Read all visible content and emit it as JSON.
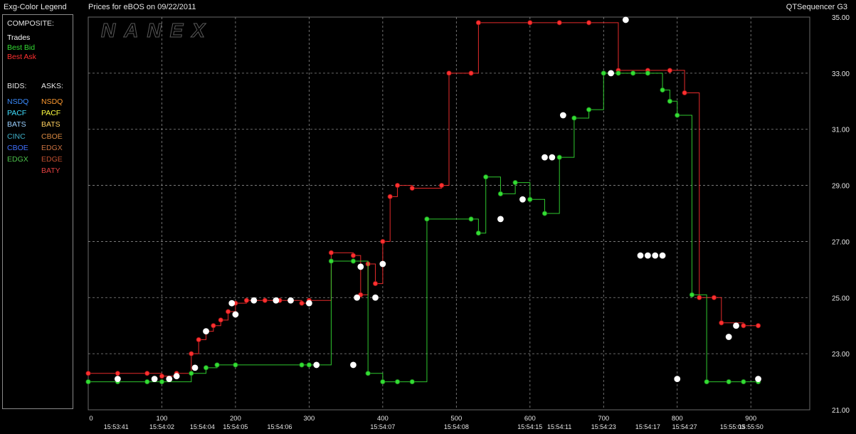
{
  "header": {
    "legend_title": "Exg-Color Legend",
    "chart_title": "Prices for  eBOS  on  09/22/2011",
    "app_name": "QTSequencer G3"
  },
  "legend": {
    "composite_label": "COMPOSITE:",
    "composite": [
      {
        "label": "Trades",
        "color": "#ffffff"
      },
      {
        "label": "Best Bid",
        "color": "#33dd33"
      },
      {
        "label": "Best Ask",
        "color": "#ff3030"
      }
    ],
    "bids_label": "BIDS:",
    "asks_label": "ASKS:",
    "bids": [
      {
        "label": "NSDQ",
        "color": "#3a8cff"
      },
      {
        "label": "PACF",
        "color": "#3fe0ff"
      },
      {
        "label": "BATS",
        "color": "#9ad0ff"
      },
      {
        "label": "CINC",
        "color": "#3fb0c8"
      },
      {
        "label": "CBOE",
        "color": "#4070ff"
      },
      {
        "label": "EDGX",
        "color": "#4cc24c"
      }
    ],
    "asks": [
      {
        "label": "NSDQ",
        "color": "#ff9a30"
      },
      {
        "label": "PACF",
        "color": "#ffff40"
      },
      {
        "label": "BATS",
        "color": "#ffd060"
      },
      {
        "label": "CBOE",
        "color": "#d88840"
      },
      {
        "label": "EDGX",
        "color": "#c87040"
      },
      {
        "label": "EDGE",
        "color": "#c05030"
      },
      {
        "label": "BATY",
        "color": "#e04040"
      }
    ]
  },
  "watermark": "NANEX",
  "chart_data": {
    "type": "line",
    "ylim": [
      21,
      35
    ],
    "xlim": [
      0,
      980
    ],
    "y_ticks": [
      21.0,
      23.0,
      25.0,
      27.0,
      29.0,
      31.0,
      33.0,
      35.0
    ],
    "y_tick_labels": [
      "21.00",
      "23.00",
      "25.00",
      "27.00",
      "29.00",
      "31.00",
      "33.00",
      "35.00"
    ],
    "x_ticks": [
      {
        "x": 0,
        "label": "0",
        "time": ""
      },
      {
        "x": 100,
        "label": "100",
        "time": "15:54:02"
      },
      {
        "x": 200,
        "label": "200",
        "time": "15:54:05"
      },
      {
        "x": 300,
        "label": "300",
        "time": ""
      },
      {
        "x": 400,
        "label": "400",
        "time": "15:54:07"
      },
      {
        "x": 500,
        "label": "500",
        "time": "15:54:08"
      },
      {
        "x": 600,
        "label": "600",
        "time": "15:54:15"
      },
      {
        "x": 700,
        "label": "700",
        "time": "15:54:23"
      },
      {
        "x": 800,
        "label": "800",
        "time": ""
      },
      {
        "x": 900,
        "label": "900",
        "time": "15:55:50"
      }
    ],
    "extra_time_labels": [
      {
        "x": 38,
        "time": "15:53:41"
      },
      {
        "x": 155,
        "time": "15:54:04"
      },
      {
        "x": 260,
        "time": "15:54:06"
      },
      {
        "x": 640,
        "time": "15:54:11"
      },
      {
        "x": 760,
        "time": "15:54:17"
      },
      {
        "x": 810,
        "time": "15:54:27"
      },
      {
        "x": 875,
        "time": "15:55:03"
      }
    ],
    "grid": "dashed",
    "series": [
      {
        "name": "Best Ask",
        "color": "#ff3030",
        "markers": true,
        "points": [
          [
            0,
            22.3
          ],
          [
            40,
            22.3
          ],
          [
            80,
            22.3
          ],
          [
            100,
            22.2
          ],
          [
            120,
            22.3
          ],
          [
            140,
            23.0
          ],
          [
            150,
            23.5
          ],
          [
            160,
            23.8
          ],
          [
            170,
            24.0
          ],
          [
            180,
            24.2
          ],
          [
            190,
            24.5
          ],
          [
            200,
            24.8
          ],
          [
            215,
            24.9
          ],
          [
            240,
            24.9
          ],
          [
            260,
            24.9
          ],
          [
            275,
            24.9
          ],
          [
            290,
            24.8
          ],
          [
            300,
            24.9
          ],
          [
            330,
            26.6
          ],
          [
            360,
            26.5
          ],
          [
            370,
            25.1
          ],
          [
            380,
            26.2
          ],
          [
            390,
            25.5
          ],
          [
            400,
            27.0
          ],
          [
            410,
            28.6
          ],
          [
            420,
            29.0
          ],
          [
            440,
            28.9
          ],
          [
            480,
            29.0
          ],
          [
            490,
            33.0
          ],
          [
            520,
            33.0
          ],
          [
            530,
            34.8
          ],
          [
            600,
            34.8
          ],
          [
            640,
            34.8
          ],
          [
            680,
            34.8
          ],
          [
            720,
            33.1
          ],
          [
            760,
            33.1
          ],
          [
            790,
            33.1
          ],
          [
            810,
            32.3
          ],
          [
            830,
            25.0
          ],
          [
            850,
            25.0
          ],
          [
            860,
            24.1
          ],
          [
            890,
            24.0
          ],
          [
            910,
            24.0
          ]
        ]
      },
      {
        "name": "Best Bid",
        "color": "#33dd33",
        "markers": true,
        "points": [
          [
            0,
            22.0
          ],
          [
            40,
            22.0
          ],
          [
            80,
            22.0
          ],
          [
            100,
            22.0
          ],
          [
            140,
            22.3
          ],
          [
            160,
            22.5
          ],
          [
            175,
            22.6
          ],
          [
            200,
            22.6
          ],
          [
            290,
            22.6
          ],
          [
            300,
            22.6
          ],
          [
            330,
            26.3
          ],
          [
            360,
            26.3
          ],
          [
            380,
            22.3
          ],
          [
            400,
            22.0
          ],
          [
            420,
            22.0
          ],
          [
            440,
            22.0
          ],
          [
            460,
            27.8
          ],
          [
            520,
            27.8
          ],
          [
            530,
            27.3
          ],
          [
            540,
            29.3
          ],
          [
            560,
            28.7
          ],
          [
            580,
            29.1
          ],
          [
            600,
            28.5
          ],
          [
            620,
            28.0
          ],
          [
            640,
            30.0
          ],
          [
            660,
            31.4
          ],
          [
            680,
            31.7
          ],
          [
            700,
            33.0
          ],
          [
            720,
            33.0
          ],
          [
            740,
            33.0
          ],
          [
            760,
            33.0
          ],
          [
            780,
            32.4
          ],
          [
            790,
            32.0
          ],
          [
            800,
            31.5
          ],
          [
            820,
            25.1
          ],
          [
            840,
            22.0
          ],
          [
            870,
            22.0
          ],
          [
            890,
            22.0
          ],
          [
            910,
            22.0
          ]
        ]
      },
      {
        "name": "Trades",
        "color": "#ffffff",
        "markers": true,
        "points": [
          [
            40,
            22.1
          ],
          [
            90,
            22.1
          ],
          [
            110,
            22.1
          ],
          [
            120,
            22.2
          ],
          [
            145,
            22.5
          ],
          [
            160,
            23.8
          ],
          [
            195,
            24.8
          ],
          [
            200,
            24.4
          ],
          [
            225,
            24.9
          ],
          [
            255,
            24.9
          ],
          [
            275,
            24.9
          ],
          [
            300,
            24.8
          ],
          [
            310,
            22.6
          ],
          [
            360,
            22.6
          ],
          [
            365,
            25.0
          ],
          [
            370,
            26.1
          ],
          [
            390,
            25.0
          ],
          [
            400,
            26.2
          ],
          [
            560,
            27.8
          ],
          [
            590,
            28.5
          ],
          [
            620,
            30.0
          ],
          [
            630,
            30.0
          ],
          [
            645,
            31.5
          ],
          [
            710,
            33.0
          ],
          [
            730,
            34.9
          ],
          [
            750,
            26.5
          ],
          [
            760,
            26.5
          ],
          [
            770,
            26.5
          ],
          [
            780,
            26.5
          ],
          [
            800,
            22.1
          ],
          [
            870,
            23.6
          ],
          [
            880,
            24.0
          ],
          [
            910,
            22.1
          ]
        ]
      }
    ]
  }
}
